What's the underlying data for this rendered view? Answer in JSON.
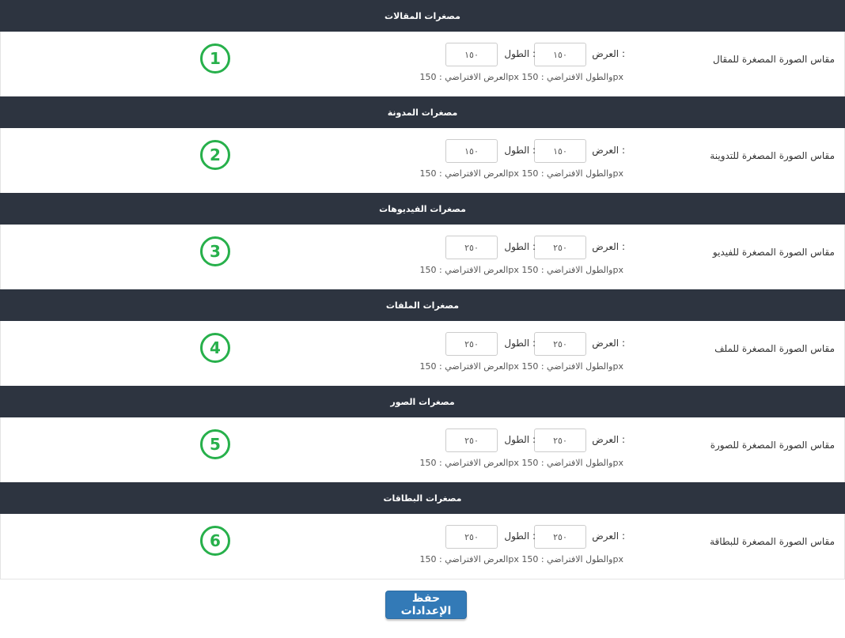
{
  "common": {
    "width_label": "العرض :",
    "height_label": "الطول :",
    "default_hint": "العرض الافتراضي : 150px والطول الافتراضي : 150px"
  },
  "sections": [
    {
      "title": "مصغرات المقالات",
      "label": "مقاس الصورة المصغرة للمقال",
      "width_value": "١٥٠",
      "height_value": "١٥٠",
      "badge": "1"
    },
    {
      "title": "مصغرات المدونة",
      "label": "مقاس الصورة المصغرة للتدوينة",
      "width_value": "١٥٠",
      "height_value": "١٥٠",
      "badge": "2"
    },
    {
      "title": "مصغرات الفيديوهات",
      "label": "مقاس الصورة المصغرة للفيديو",
      "width_value": "٢٥٠",
      "height_value": "٢٥٠",
      "badge": "3"
    },
    {
      "title": "مصغرات الملفات",
      "label": "مقاس الصورة المصغرة للملف",
      "width_value": "٢٥٠",
      "height_value": "٢٥٠",
      "badge": "4"
    },
    {
      "title": "مصغرات الصور",
      "label": "مقاس الصورة المصغرة للصورة",
      "width_value": "٢٥٠",
      "height_value": "٢٥٠",
      "badge": "5"
    },
    {
      "title": "مصغرات البطاقات",
      "label": "مقاس الصورة المصغرة للبطاقة",
      "width_value": "٢٥٠",
      "height_value": "٢٥٠",
      "badge": "6"
    }
  ],
  "save_button": "حفظ الإعدادات",
  "colors": {
    "header_bg": "#2d3440",
    "badge": "#27b04b",
    "button": "#337ab7"
  }
}
